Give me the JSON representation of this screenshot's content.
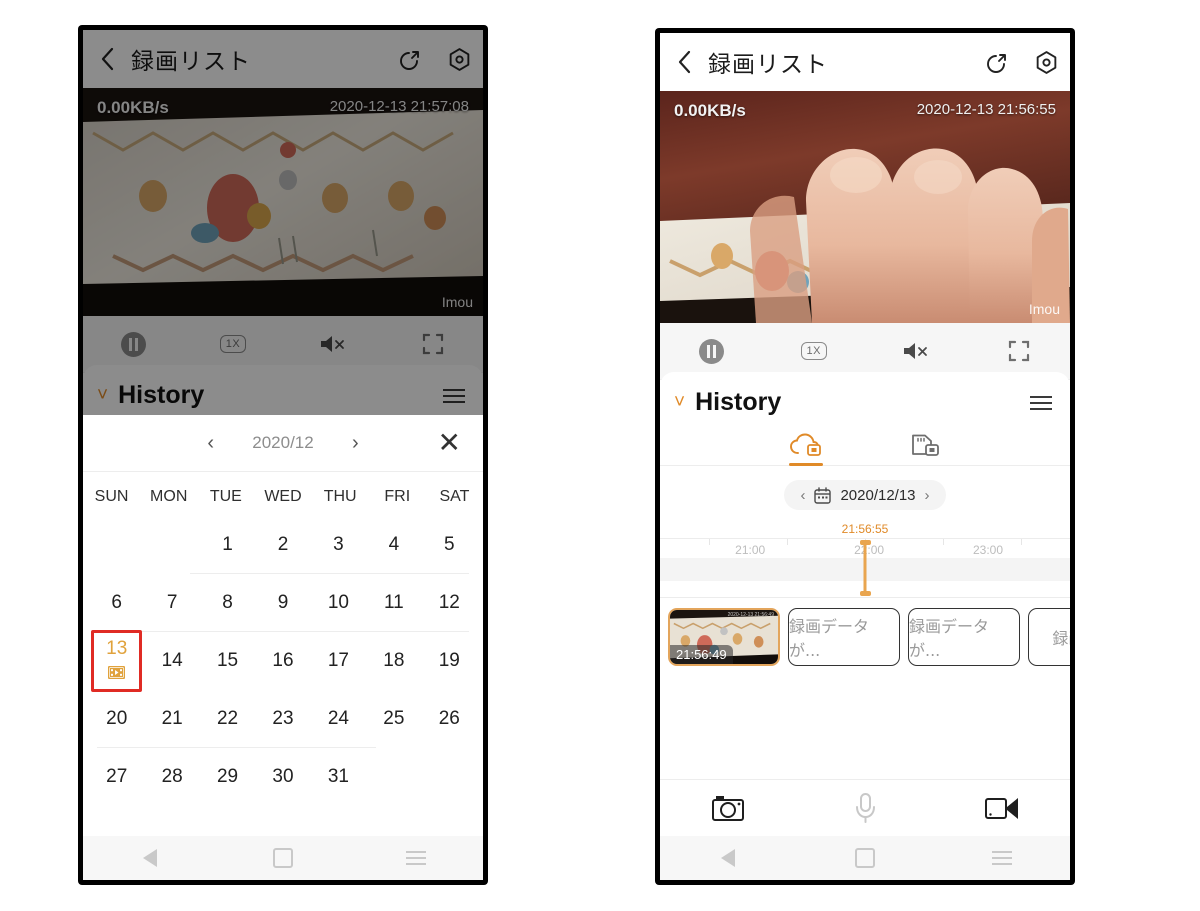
{
  "left_phone": {
    "header": {
      "back_icon": "chevron-left-icon",
      "title": "録画リスト",
      "share_icon": "share-icon",
      "settings_icon": "settings-icon"
    },
    "video": {
      "bitrate": "0.00KB/s",
      "timestamp": "2020-12-13 21:57:08",
      "watermark": "Imou"
    },
    "controls": {
      "pause_icon": "pause-icon",
      "speed_label": "1X",
      "mute_icon": "speaker-mute-icon",
      "fullscreen_icon": "fullscreen-icon"
    },
    "history": {
      "title": "History",
      "chevron_icon": "chevron-down-icon",
      "menu_icon": "hamburger-menu-icon"
    },
    "calendar": {
      "prev_icon": "chevron-left-icon",
      "month_label": "2020/12",
      "next_icon": "chevron-right-icon",
      "close_icon": "close-icon",
      "weekday_headers": [
        "SUN",
        "MON",
        "TUE",
        "WED",
        "THU",
        "FRI",
        "SAT"
      ],
      "weeks": [
        [
          "",
          "",
          "1",
          "2",
          "3",
          "4",
          "5"
        ],
        [
          "6",
          "7",
          "8",
          "9",
          "10",
          "11",
          "12"
        ],
        [
          "13",
          "14",
          "15",
          "16",
          "17",
          "18",
          "19"
        ],
        [
          "20",
          "21",
          "22",
          "23",
          "24",
          "25",
          "26"
        ],
        [
          "27",
          "28",
          "29",
          "30",
          "31",
          "",
          ""
        ]
      ],
      "selected_day": "13",
      "selected_day_has_recording": true,
      "recording_icon": "film-strip-icon",
      "selected_highlight_color": "#e02b24",
      "selected_text_color": "#e0a23c"
    },
    "navbar": {
      "back_icon": "android-back-icon",
      "home_icon": "android-home-icon",
      "recents_icon": "android-recents-icon"
    }
  },
  "right_phone": {
    "header": {
      "back_icon": "chevron-left-icon",
      "title": "録画リスト",
      "share_icon": "share-icon",
      "settings_icon": "settings-icon"
    },
    "video": {
      "bitrate": "0.00KB/s",
      "timestamp": "2020-12-13 21:56:55",
      "watermark": "Imou"
    },
    "controls": {
      "pause_icon": "pause-icon",
      "speed_label": "1X",
      "mute_icon": "speaker-mute-icon",
      "fullscreen_icon": "fullscreen-icon"
    },
    "history": {
      "title": "History",
      "chevron_icon": "chevron-down-icon",
      "menu_icon": "hamburger-menu-icon",
      "tabs": [
        {
          "name": "cloud-storage-tab",
          "icon": "cloud-video-icon",
          "active": true
        },
        {
          "name": "sd-card-tab",
          "icon": "sd-card-video-icon",
          "active": false
        }
      ],
      "active_tab_color": "#e08a28"
    },
    "date_selector": {
      "prev_icon": "chevron-left-icon",
      "calendar_icon": "calendar-icon",
      "date_label": "2020/12/13",
      "next_icon": "chevron-right-icon"
    },
    "timeline": {
      "playhead_time": "21:56:55",
      "playhead_color": "#e9a54f",
      "tick_labels": [
        "21:00",
        "22:00",
        "23:00"
      ],
      "playhead_position_percent": 50
    },
    "clips": [
      {
        "type": "thumbnail",
        "time_label": "21:56:49",
        "selected": true,
        "corner_stamp": "2020-12-13 21:56:49"
      },
      {
        "type": "placeholder",
        "label": "録画データが..."
      },
      {
        "type": "placeholder",
        "label": "録画データが..."
      },
      {
        "type": "placeholder",
        "label": "録画デ..."
      }
    ],
    "action_bar": {
      "snapshot_icon": "camera-icon",
      "talk_icon": "microphone-icon",
      "record_icon": "video-camera-icon"
    },
    "navbar": {
      "back_icon": "android-back-icon",
      "home_icon": "android-home-icon",
      "recents_icon": "android-recents-icon"
    }
  }
}
